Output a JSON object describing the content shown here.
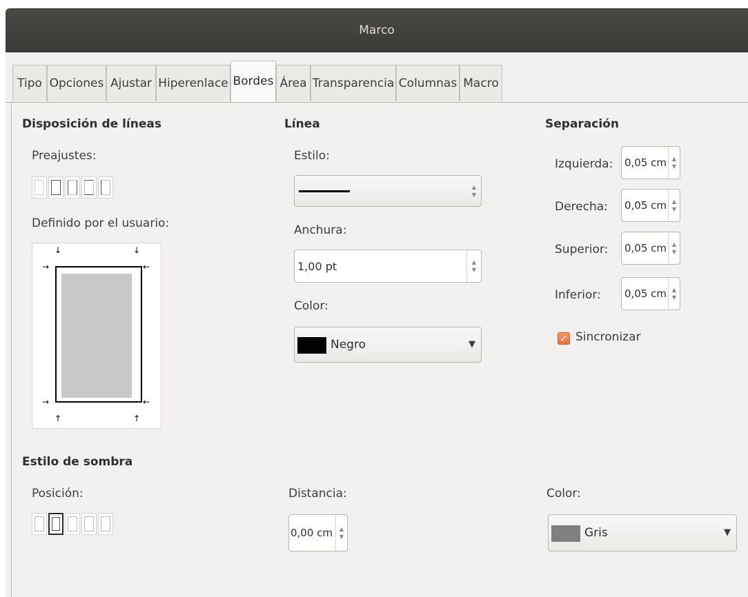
{
  "window": {
    "title": "Marco"
  },
  "tabs": [
    "Tipo",
    "Opciones",
    "Ajustar",
    "Hiperenlace",
    "Bordes",
    "Área",
    "Transparencia",
    "Columnas",
    "Macro"
  ],
  "active_tab": "Bordes",
  "line_arrangement": {
    "title": "Disposición de líneas",
    "presets_label": "Preajustes:",
    "user_defined_label": "Definido por el usuario:"
  },
  "line": {
    "title": "Línea",
    "style_label": "Estilo:",
    "width_label": "Anchura:",
    "width_value": "1,00 pt",
    "color_label": "Color:",
    "color_value": "Negro",
    "color_hex": "#000000"
  },
  "spacing": {
    "title": "Separación",
    "left_label": "Izquierda:",
    "left_value": "0,05 cm",
    "right_label": "Derecha:",
    "right_value": "0,05 cm",
    "top_label": "Superior:",
    "top_value": "0,05 cm",
    "bottom_label": "Inferior:",
    "bottom_value": "0,05 cm",
    "sync_label": "Sincronizar",
    "sync_checked": true
  },
  "shadow": {
    "title": "Estilo de sombra",
    "position_label": "Posición:",
    "distance_label": "Distancia:",
    "distance_value": "0,00 cm",
    "color_label": "Color:",
    "color_value": "Gris",
    "color_hex": "#808080"
  },
  "colors": {
    "titlebar": "#3f3e3a",
    "panel": "#f2f1f0",
    "accent": "#e9713f"
  }
}
